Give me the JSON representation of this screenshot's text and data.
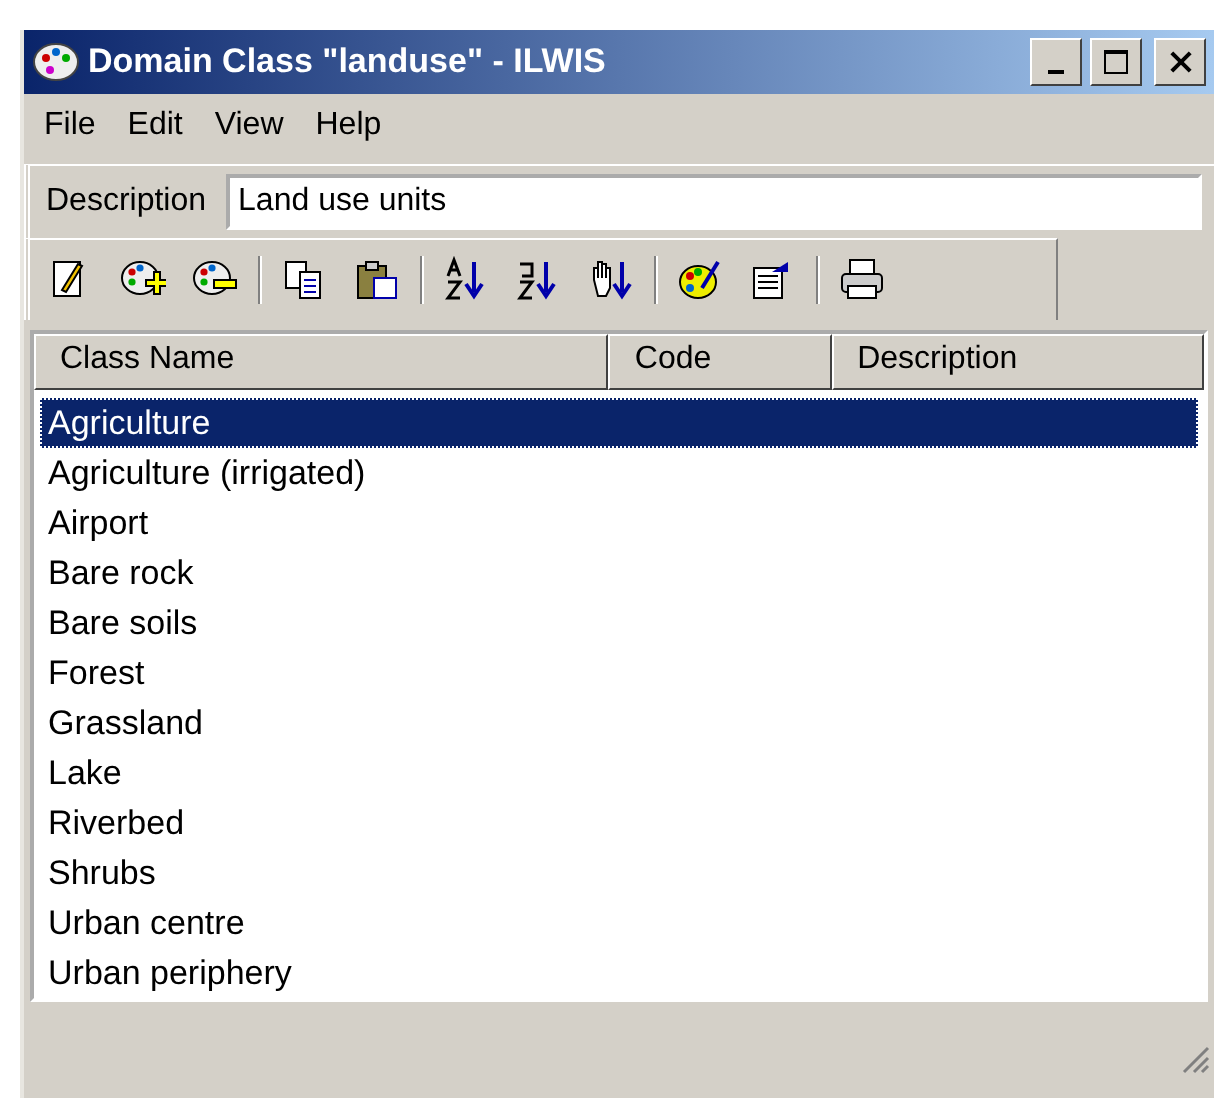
{
  "window": {
    "title": "Domain Class \"landuse\" - ILWIS"
  },
  "menu": [
    "File",
    "Edit",
    "View",
    "Help"
  ],
  "description": {
    "label": "Description",
    "value": "Land use units"
  },
  "toolbar": [
    [
      {
        "kind": "edit"
      },
      {
        "kind": "add"
      },
      {
        "kind": "remove"
      }
    ],
    [
      {
        "kind": "copy"
      },
      {
        "kind": "paste"
      }
    ],
    [
      {
        "kind": "sort-az"
      },
      {
        "kind": "sort-za"
      },
      {
        "kind": "sort-hand"
      }
    ],
    [
      {
        "kind": "palette"
      },
      {
        "kind": "properties"
      }
    ],
    [
      {
        "kind": "print"
      }
    ]
  ],
  "table": {
    "columns": [
      "Class Name",
      "Code",
      "Description"
    ],
    "rows": [
      {
        "name": "Agriculture",
        "selected": true
      },
      {
        "name": "Agriculture (irrigated)",
        "selected": false
      },
      {
        "name": "Airport",
        "selected": false
      },
      {
        "name": "Bare rock",
        "selected": false
      },
      {
        "name": "Bare soils",
        "selected": false
      },
      {
        "name": "Forest",
        "selected": false
      },
      {
        "name": "Grassland",
        "selected": false
      },
      {
        "name": "Lake",
        "selected": false
      },
      {
        "name": "Riverbed",
        "selected": false
      },
      {
        "name": "Shrubs",
        "selected": false
      },
      {
        "name": "Urban centre",
        "selected": false
      },
      {
        "name": "Urban periphery",
        "selected": false
      }
    ]
  }
}
